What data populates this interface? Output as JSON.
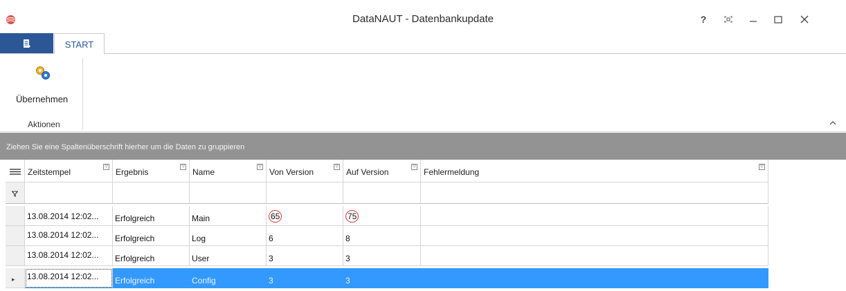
{
  "window": {
    "title": "DataNAUT - Datenbankupdate",
    "help_label": "?",
    "restore_label": "⌗",
    "minimize_label": "—",
    "maximize_label": "☐",
    "close_label": "✕"
  },
  "ribbon": {
    "tab_start": "START",
    "button_apply": "Übernehmen",
    "group_actions": "Aktionen",
    "collapse_label": "⌃"
  },
  "group_panel": {
    "hint": "Ziehen Sie eine Spaltenüberschrift hierher um die Daten zu gruppieren"
  },
  "grid": {
    "columns": [
      "Zeitstempel",
      "Ergebnis",
      "Name",
      "Von Version",
      "Auf Version",
      "Fehlermeldung"
    ],
    "rows": [
      [
        "13.08.2014 12:02...",
        "Erfolgreich",
        "Main",
        "65",
        "75",
        ""
      ],
      [
        "13.08.2014 12:02...",
        "Erfolgreich",
        "Log",
        "6",
        "8",
        ""
      ],
      [
        "13.08.2014 12:02...",
        "Erfolgreich",
        "User",
        "3",
        "3",
        ""
      ],
      [
        "13.08.2014 12:02...",
        "Erfolgreich",
        "Config",
        "3",
        "3",
        ""
      ]
    ],
    "selected_row": 3,
    "filter_row_icon": "filter-icon",
    "current_row_marker": "▸",
    "colors": {
      "selection": "#3399ff",
      "group_panel": "#939393",
      "file_tab": "#2b5797",
      "highlight_circle": "#e03030"
    }
  }
}
